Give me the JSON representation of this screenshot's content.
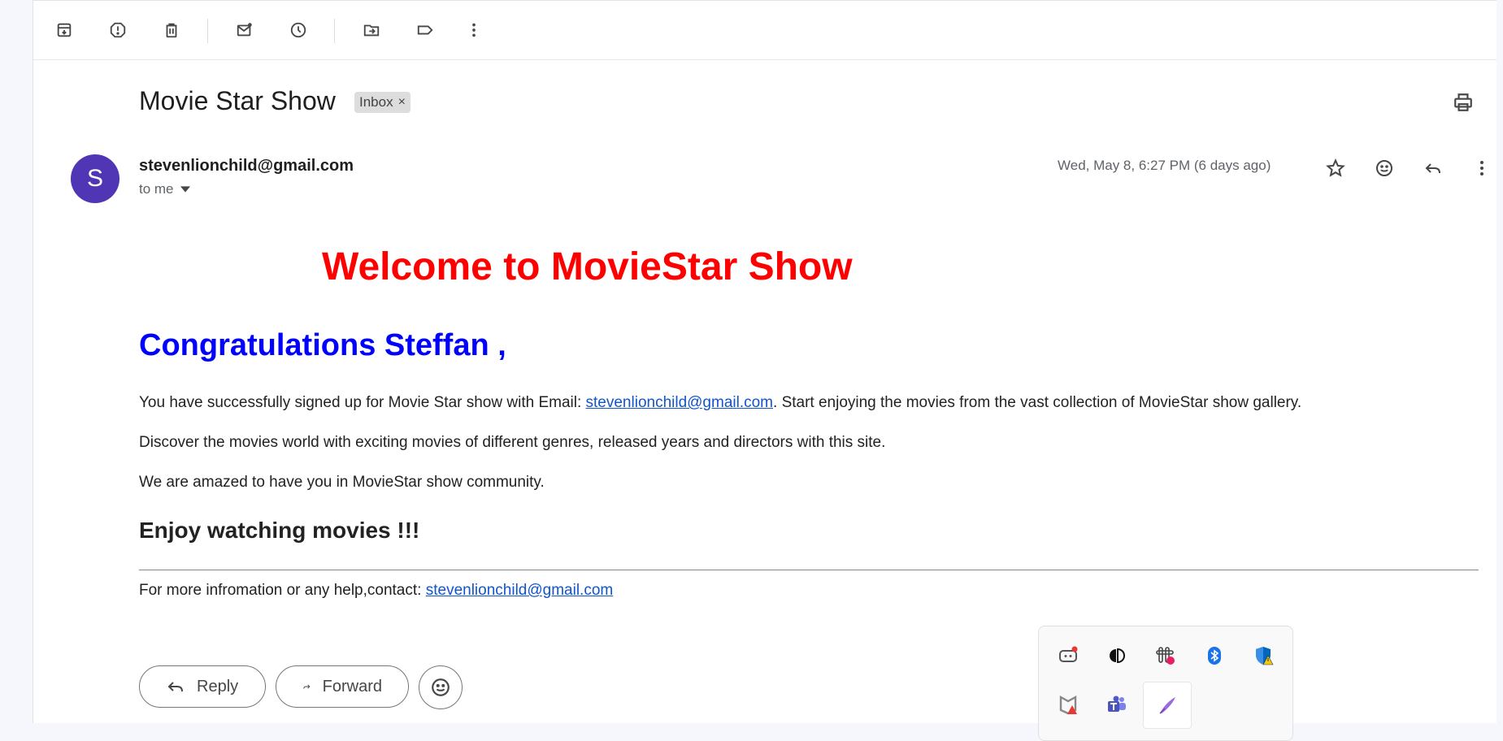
{
  "toolbar": {
    "icons": [
      "archive-icon",
      "report-spam-icon",
      "delete-icon",
      "mark-unread-icon",
      "snooze-icon",
      "move-to-icon",
      "label-icon",
      "more-vert-icon"
    ]
  },
  "email": {
    "subject": "Movie Star Show",
    "chip_label": "Inbox",
    "chip_close": "×",
    "avatar_letter": "S",
    "sender": "stevenlionchild@gmail.com",
    "to": "to me",
    "date": "Wed, May 8, 6:27 PM (6 days ago)"
  },
  "body": {
    "welcome": "Welcome to MovieStar Show",
    "congrats": "Congratulations Steffan ,",
    "p1_before": "You have successfully signed up for Movie Star show with Email: ",
    "p1_link": "stevenlionchild@gmail.com",
    "p1_after": ". Start enjoying the movies from the vast collection of MovieStar show gallery.",
    "p2": "Discover the movies world with exciting movies of different genres, released years and directors with this site.",
    "p3": "We are amazed to have you in MovieStar show community.",
    "enjoy": "Enjoy watching movies !!!",
    "footer_before": "For more infromation or any help,contact: ",
    "footer_link": "stevenlionchild@gmail.com"
  },
  "actions": {
    "reply": "Reply",
    "forward": "Forward"
  },
  "colors": {
    "welcome": "#ff0000",
    "congrats": "#0000ff",
    "link": "#1155cc",
    "avatar": "#5035b5"
  },
  "tray": {
    "icons": [
      "copilot-icon",
      "dolby-icon",
      "slack-icon",
      "bluetooth-icon",
      "defender-icon",
      "mcafee-icon",
      "teams-icon",
      "pen-icon"
    ]
  }
}
